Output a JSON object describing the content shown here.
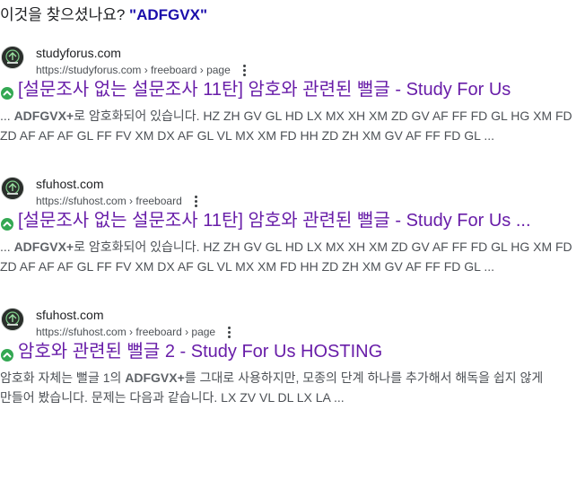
{
  "query": {
    "prefix": "이것을 찾으셨나요?",
    "term": "\"ADFGVX\""
  },
  "results": [
    {
      "site_name": "studyforus.com",
      "url": "https://studyforus.com › freeboard › page",
      "title": "[설문조사 없는 설문조사 11탄] 암호와 관련된 뻘글 - Study For Us",
      "snippet_line1_pre": "... ",
      "snippet_line1_bold": "ADFGVX+",
      "snippet_line1_post": "로 암호화되어 있습니다. HZ ZH GV GL HD LX MX XH XM ZD GV AF FF FD GL HG XM FD",
      "snippet_line2": "ZD AF AF AF GL FF FV XM DX AF GL VL MX XM FD HH ZD ZH XM GV AF FF FD GL ...",
      "favicon_icon": "study-for-us-logo-icon"
    },
    {
      "site_name": "sfuhost.com",
      "url": "https://sfuhost.com › freeboard",
      "title": "[설문조사 없는 설문조사 11탄] 암호와 관련된 뻘글 - Study For Us ...",
      "snippet_line1_pre": "... ",
      "snippet_line1_bold": "ADFGVX+",
      "snippet_line1_post": "로 암호화되어 있습니다. HZ ZH GV GL HD LX MX XH XM ZD GV AF FF FD GL HG XM FD",
      "snippet_line2": "ZD AF AF AF GL FF FV XM DX AF GL VL MX XM FD HH ZD ZH XM GV AF FF FD GL ...",
      "favicon_icon": "study-for-us-logo-icon"
    },
    {
      "site_name": "sfuhost.com",
      "url": "https://sfuhost.com › freeboard › page",
      "title": "암호와 관련된 뻘글 2 - Study For Us HOSTING",
      "snippet_line1_pre": "암호화 자체는 뻘글 1의 ",
      "snippet_line1_bold": "ADFGVX+",
      "snippet_line1_post": "를 그대로 사용하지만, 모종의 단계 하나를 추가해서 해독을 쉽지 않게",
      "snippet_line2": "만들어 봤습니다. 문제는 다음과 같습니다. LX ZV VL DL LX LA ...",
      "favicon_icon": "study-for-us-logo-icon"
    }
  ],
  "colors": {
    "visited_link": "#681da8",
    "query_term": "#1a0dab",
    "badge_green": "#34a853",
    "snippet_text": "#4d5156"
  },
  "icons": {
    "more_options": "kebab-menu-icon",
    "title_badge": "up-arrow-badge-icon"
  }
}
